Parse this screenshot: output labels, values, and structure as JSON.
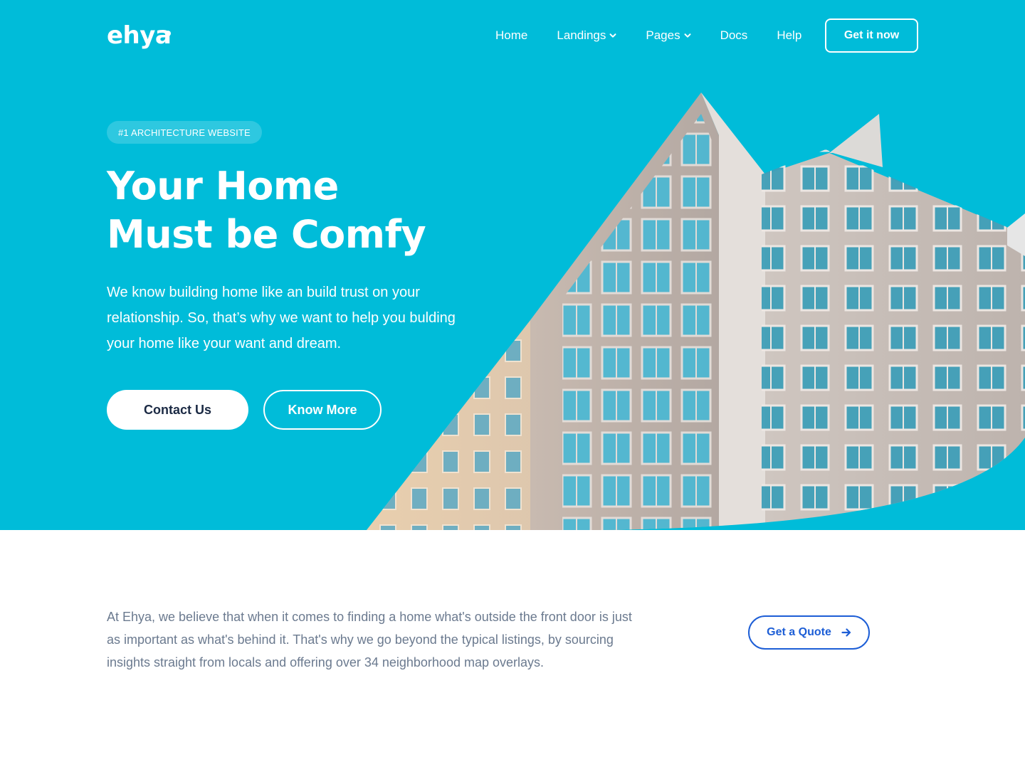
{
  "brand": {
    "logo_text": "ehya"
  },
  "nav": {
    "links": [
      {
        "label": "Home",
        "has_dropdown": false
      },
      {
        "label": "Landings",
        "has_dropdown": true
      },
      {
        "label": "Pages",
        "has_dropdown": true
      },
      {
        "label": "Docs",
        "has_dropdown": false
      },
      {
        "label": "Help",
        "has_dropdown": false
      }
    ],
    "cta_label": "Get it now"
  },
  "hero": {
    "badge": "#1 ARCHITECTURE WEBSITE",
    "title_line1": "Your Home",
    "title_line2": "Must be Comfy",
    "text": "We know building home like an build trust on your relationship. So, that’s why we want to help you bulding your home like your want and dream.",
    "primary_button": "Contact Us",
    "secondary_button": "Know More"
  },
  "about": {
    "text": "At Ehya, we believe that when it comes to finding a home what's outside the front door is just as important as what's behind it. That's why we go beyond the typical listings, by sourcing insights straight from locals and offering over 34 neighborhood map overlays.",
    "quote_button": "Get a Quote"
  },
  "colors": {
    "hero_bg": "#00bcd9",
    "primary_blue": "#1d5ed6",
    "heading_dark": "#1b2a44",
    "body_gray": "#6b7a8f"
  },
  "icons": {
    "dropdown": "chevron-down-icon",
    "quote_arrow": "arrow-right-icon"
  }
}
